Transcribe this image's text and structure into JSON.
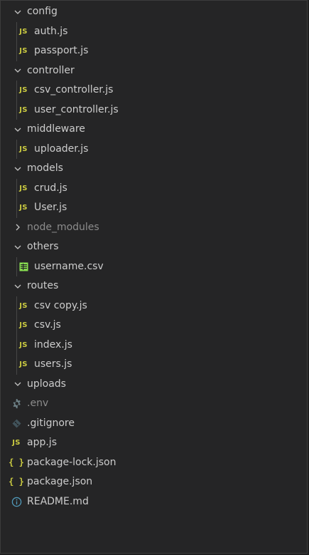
{
  "explorer": {
    "tree": [
      {
        "kind": "folder",
        "label": "config",
        "expanded": true
      },
      {
        "kind": "file",
        "label": "auth.js",
        "icon": "js-icon",
        "depth": 1
      },
      {
        "kind": "file",
        "label": "passport.js",
        "icon": "js-icon",
        "depth": 1
      },
      {
        "kind": "folder",
        "label": "controller",
        "expanded": true
      },
      {
        "kind": "file",
        "label": "csv_controller.js",
        "icon": "js-icon",
        "depth": 1
      },
      {
        "kind": "file",
        "label": "user_controller.js",
        "icon": "js-icon",
        "depth": 1
      },
      {
        "kind": "folder",
        "label": "middleware",
        "expanded": true
      },
      {
        "kind": "file",
        "label": "uploader.js",
        "icon": "js-icon",
        "depth": 1
      },
      {
        "kind": "folder",
        "label": "models",
        "expanded": true
      },
      {
        "kind": "file",
        "label": "crud.js",
        "icon": "js-icon",
        "depth": 1
      },
      {
        "kind": "file",
        "label": "User.js",
        "icon": "js-icon",
        "depth": 1
      },
      {
        "kind": "folder",
        "label": "node_modules",
        "expanded": false,
        "dimmed": true
      },
      {
        "kind": "folder",
        "label": "others",
        "expanded": true
      },
      {
        "kind": "file",
        "label": "username.csv",
        "icon": "csv-icon",
        "depth": 1
      },
      {
        "kind": "folder",
        "label": "routes",
        "expanded": true
      },
      {
        "kind": "file",
        "label": "csv copy.js",
        "icon": "js-icon",
        "depth": 1
      },
      {
        "kind": "file",
        "label": "csv.js",
        "icon": "js-icon",
        "depth": 1
      },
      {
        "kind": "file",
        "label": "index.js",
        "icon": "js-icon",
        "depth": 1
      },
      {
        "kind": "file",
        "label": "users.js",
        "icon": "js-icon",
        "depth": 1
      },
      {
        "kind": "folder",
        "label": "uploads",
        "expanded": true
      },
      {
        "kind": "file",
        "label": ".env",
        "icon": "gear-icon",
        "depth": 0,
        "dimmed": true
      },
      {
        "kind": "file",
        "label": ".gitignore",
        "icon": "git-icon",
        "depth": 0
      },
      {
        "kind": "file",
        "label": "app.js",
        "icon": "js-icon",
        "depth": 0
      },
      {
        "kind": "file",
        "label": "package-lock.json",
        "icon": "json-icon",
        "depth": 0
      },
      {
        "kind": "file",
        "label": "package.json",
        "icon": "json-icon",
        "depth": 0
      },
      {
        "kind": "file",
        "label": "README.md",
        "icon": "info-icon",
        "depth": 0
      }
    ],
    "icon_glyphs": {
      "js": "JS",
      "json": "{ }"
    },
    "colors": {
      "background": "#252526",
      "text": "#cccccc",
      "dimmed_text": "#8c8c8c",
      "js_icon": "#cbcb41",
      "json_icon": "#cbcb41",
      "csv_icon": "#89e051",
      "info_icon": "#519aba",
      "git_icon": "#41535b",
      "gear_icon": "#6d8086"
    }
  }
}
